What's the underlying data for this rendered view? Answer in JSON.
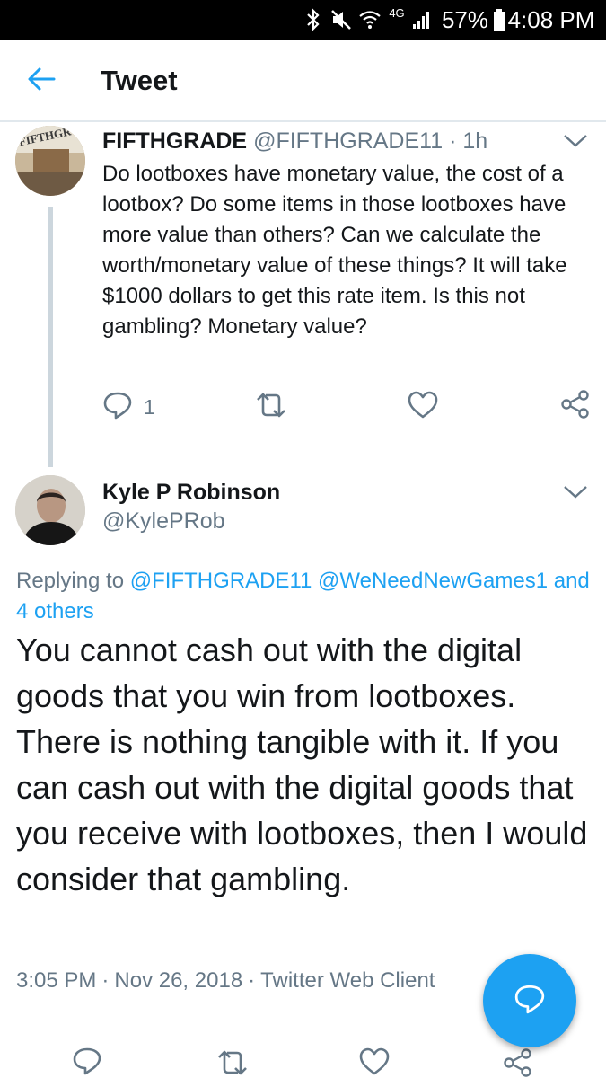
{
  "status_bar": {
    "network": "4G",
    "battery": "57%",
    "time": "4:08 PM",
    "icons": [
      "bluetooth-icon",
      "mute-icon",
      "wifi-icon",
      "signal-icon",
      "battery-icon"
    ]
  },
  "header": {
    "title": "Tweet",
    "back_icon": "arrow-left-icon"
  },
  "parent_tweet": {
    "display_name": "FIFTHGRADE",
    "handle": "@FIFTHGRADE11",
    "separator": "·",
    "time": "1h",
    "text": "Do lootboxes have monetary value, the cost of a lootbox? Do some items in those lootboxes have more value than others? Can we calculate the worth/monetary value of these things? It will take $1000 dollars to get this rate item. Is this not gambling? Monetary value?",
    "reply_count": "1",
    "avatar_text": "FIFTHGR"
  },
  "reply_tweet": {
    "display_name": "Kyle P Robinson",
    "handle": "@KylePRob",
    "replying_prefix": "Replying to",
    "replying_mention_1": "@FIFTHGRADE11",
    "replying_mention_2": "@WeNeedNewGames1",
    "replying_others": "and 4 others",
    "text": "You cannot cash out with the digital goods that you win from lootboxes. There is nothing tangible with it. If you can cash out with the digital goods that you receive with lootboxes, then I would consider that gambling.",
    "time": "3:05 PM",
    "date": "Nov 26, 2018",
    "source": "Twitter Web Client",
    "separator": "·"
  },
  "colors": {
    "accent": "#1da1f2",
    "text_primary": "#14171a",
    "text_secondary": "#657786",
    "divider": "#e1e8ed"
  }
}
